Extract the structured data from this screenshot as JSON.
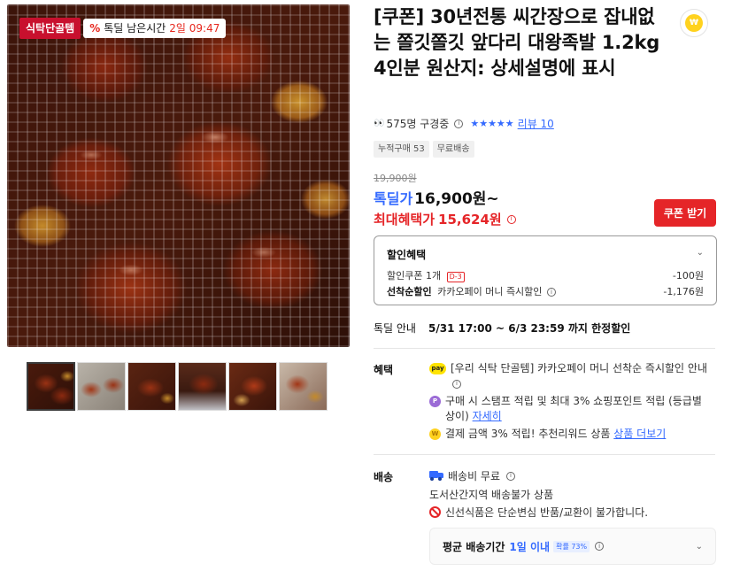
{
  "gallery": {
    "category_badge": "식탁단골템",
    "timer_icon": "%",
    "timer_label": "톡딜 남은시간",
    "timer_value": "2일 09:47",
    "thumbnails": [
      "thumb-1",
      "thumb-2",
      "thumb-3",
      "thumb-4",
      "thumb-5",
      "thumb-6"
    ]
  },
  "product": {
    "title": "[쿠폰] 30년전통 씨간장으로 잡내없는 쫄깃쫄깃 앞다리 대왕족발 1.2kg 4인분 원산지: 상세설명에 표시",
    "seller_logo_icon": "coin-logo-icon",
    "viewers_icon": "👀",
    "viewers_text": "575명 구경중",
    "stars": "★★★★★",
    "review_text": "리뷰 10",
    "tags": [
      "누적구매 53",
      "무료배송"
    ]
  },
  "price": {
    "original": "19,900원",
    "deal_label": "톡딜가",
    "deal_price": "16,900원~",
    "max_label": "최대혜택가",
    "max_price": "15,624원",
    "coupon_button": "쿠폰 받기"
  },
  "discount": {
    "title": "할인혜택",
    "coupon_label": "할인쿠폰 1개",
    "coupon_badge": "D-3",
    "coupon_amount": "-100원",
    "first_label": "선착순할인",
    "first_desc": "카카오페이 머니 즉시할인",
    "first_amount": "-1,176원"
  },
  "deal_info": {
    "label": "톡딜 안내",
    "value": "5/31 17:00 ~ 6/3 23:59 까지 한정할인"
  },
  "benefits": {
    "label": "혜택",
    "items": [
      {
        "icon": "pay",
        "text": "[우리 식탁 단골템] 카카오페이 머니 선착순 즉시할인 안내",
        "link": ""
      },
      {
        "icon": "P",
        "text": "구매 시 스탬프 적립 및 최대 3% 쇼핑포인트 적립 (등급별 상이)",
        "link": "자세히"
      },
      {
        "icon": "W",
        "text": "결제 금액 3% 적립! 추천리워드 상품",
        "link": "상품 더보기"
      }
    ]
  },
  "shipping": {
    "label": "배송",
    "fee": "배송비 무료",
    "restriction": "도서산간지역 배송불가 상품",
    "return_notice": "신선식품은 단순변심 반품/교환이 불가합니다.",
    "avg_label": "평균 배송기간",
    "avg_value": "1일 이내",
    "avg_prob": "확률 73%"
  },
  "colors": {
    "accent_blue": "#346aff",
    "accent_red": "#e52528",
    "badge_red": "#c8102e"
  }
}
